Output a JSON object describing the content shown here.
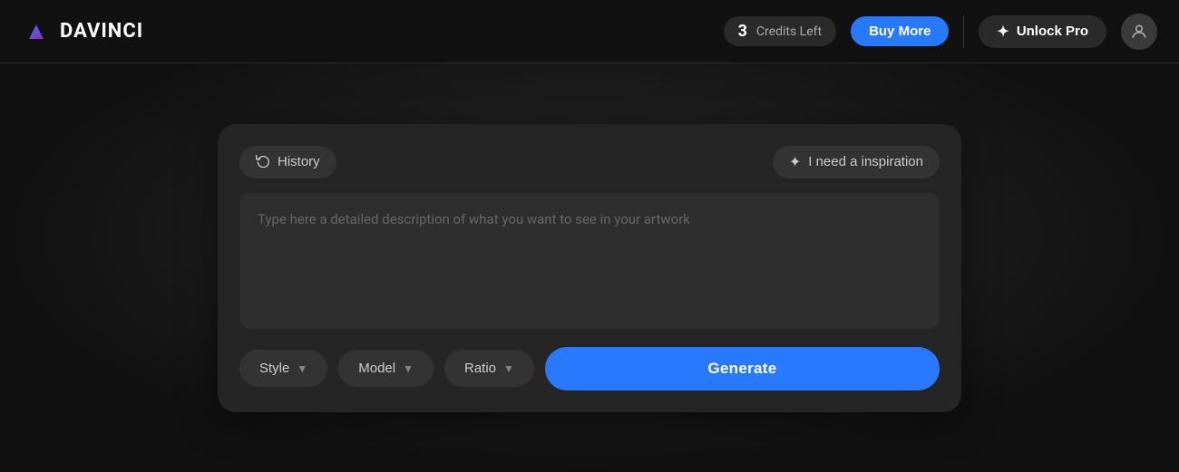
{
  "navbar": {
    "logo_text": "DAVINCI",
    "credits_number": "3",
    "credits_label": "Credits Left",
    "buy_more_label": "Buy More",
    "unlock_pro_label": "Unlock Pro",
    "sparkle_icon": "✦",
    "history_icon": "↺",
    "avatar_icon": "👤"
  },
  "card": {
    "history_button_label": "History",
    "inspiration_button_label": "I need a inspiration",
    "textarea_placeholder": "Type here a detailed description of what you want to see in your artwork",
    "style_dropdown_label": "Style",
    "model_dropdown_label": "Model",
    "ratio_dropdown_label": "Ratio",
    "generate_button_label": "Generate"
  }
}
